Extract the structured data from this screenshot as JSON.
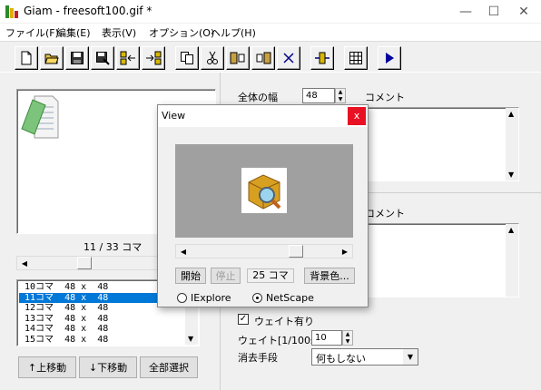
{
  "window": {
    "title": "Giam - freesoft100.gif *",
    "minimize": "—",
    "maximize": "☐",
    "close": "✕"
  },
  "menu": [
    {
      "label": "ファイル(F)"
    },
    {
      "label": "編集(E)"
    },
    {
      "label": "表示(V)"
    },
    {
      "label": "オプション(O)"
    },
    {
      "label": "ヘルプ(H)"
    }
  ],
  "toolbar": {
    "icons": [
      "new-file-icon",
      "open-folder-icon",
      "save-icon",
      "save-as-icon",
      "insert-frame-before-icon",
      "insert-frame-after-icon",
      "copy-icon",
      "cut-icon",
      "paste-before-icon",
      "paste-after-icon",
      "delete-icon",
      "resize-icon",
      "grid-icon",
      "play-icon"
    ]
  },
  "left": {
    "frame_counter": "11 / 33 コマ",
    "frames": [
      {
        "label": "10コマ  48 x  48",
        "selected": false
      },
      {
        "label": "11コマ  48 x  48",
        "selected": true
      },
      {
        "label": "12コマ  48 x  48",
        "selected": false
      },
      {
        "label": "13コマ  48 x  48",
        "selected": false
      },
      {
        "label": "14コマ  48 x  48",
        "selected": false
      },
      {
        "label": "15コマ  48 x  48",
        "selected": false
      }
    ],
    "btn_up": "↑上移動",
    "btn_down": "↓下移動",
    "btn_select_all": "全部選択"
  },
  "right": {
    "width_label": "全体の幅",
    "width_value": "48",
    "comment_label_1": "コメント",
    "comment_label_2": "コメント",
    "wait_check": "ウェイト有り",
    "wait_checked": true,
    "wait_label": "ウェイト[1/100s]",
    "wait_value": "10",
    "disposal_label": "消去手段",
    "disposal_value": "何もしない"
  },
  "dialog": {
    "title": "View",
    "close": "x",
    "btn_start": "開始",
    "btn_stop": "停止",
    "frames_text": "25 コマ",
    "btn_bgcolor": "背景色...",
    "radio_ie": "IExplore",
    "radio_ns": "NetScape",
    "selected_radio": "NetScape"
  },
  "colors": {
    "selection": "#0078d7",
    "close_red": "#e81123",
    "preview_gray": "#a0a0a0"
  }
}
